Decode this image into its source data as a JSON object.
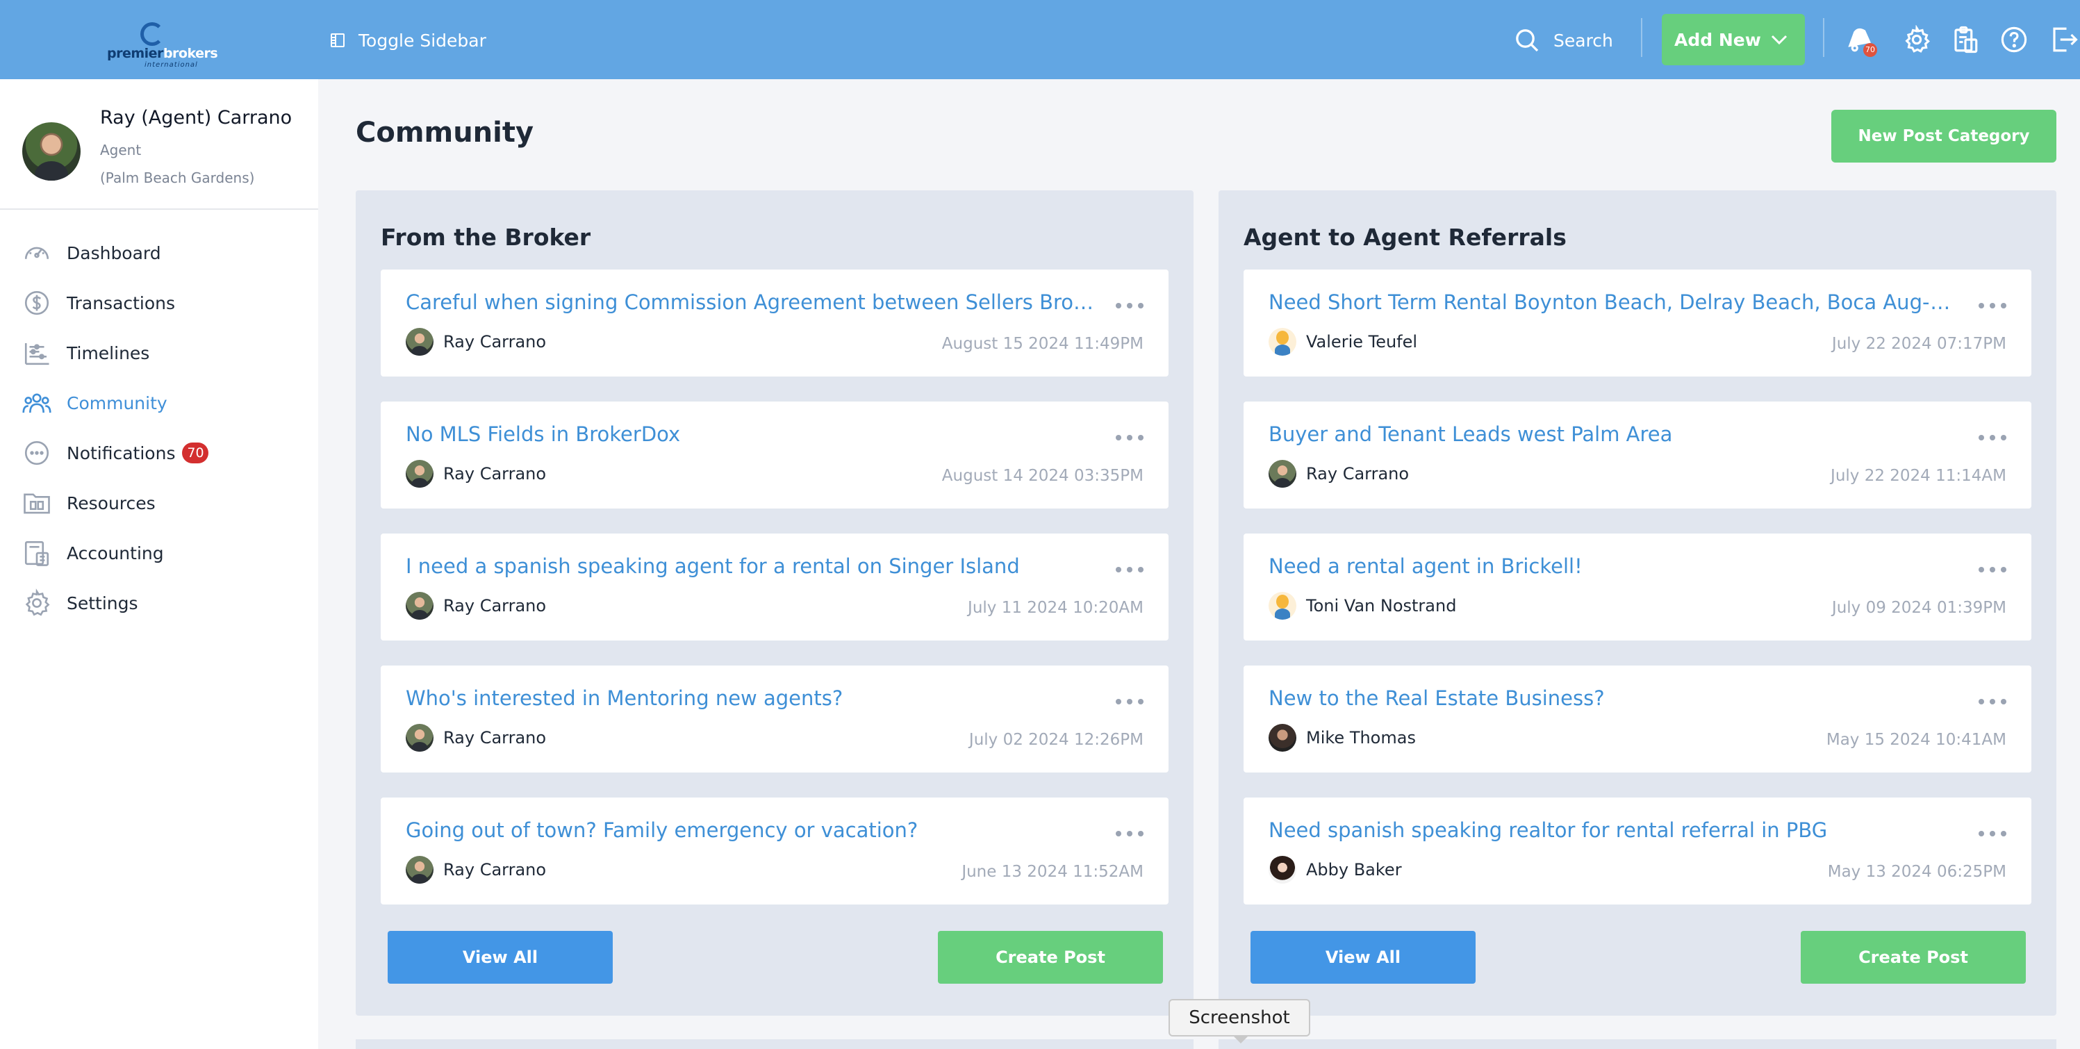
{
  "header": {
    "logo_text_left": "premier",
    "logo_text_right": "brokers",
    "logo_sub": "international",
    "toggle_label": "Toggle Sidebar",
    "search_label": "Search",
    "add_new_label": "Add New",
    "notification_count": "70",
    "accent_color": "#62a6e3"
  },
  "profile": {
    "name": "Ray (Agent) Carrano",
    "role": "Agent",
    "location": "(Palm Beach Gardens)"
  },
  "nav": [
    {
      "label": "Dashboard",
      "icon": "speedometer-icon"
    },
    {
      "label": "Transactions",
      "icon": "dollar-icon"
    },
    {
      "label": "Timelines",
      "icon": "timeline-icon"
    },
    {
      "label": "Community",
      "icon": "people-icon",
      "active": true
    },
    {
      "label": "Notifications",
      "icon": "chat-icon",
      "badge": "70"
    },
    {
      "label": "Resources",
      "icon": "folder-icon"
    },
    {
      "label": "Accounting",
      "icon": "calculator-icon"
    },
    {
      "label": "Settings",
      "icon": "gear-icon"
    }
  ],
  "main": {
    "title": "Community",
    "new_category_label": "New Post Category",
    "panels": [
      {
        "title": "From the Broker",
        "view_all_label": "View All",
        "create_label": "Create Post",
        "posts": [
          {
            "title": "Careful when signing Commission Agreement between Sellers Brokers",
            "author": "Ray Carrano",
            "date": "August 15 2024 11:49PM"
          },
          {
            "title": "No MLS Fields in BrokerDox",
            "author": "Ray Carrano",
            "date": "August 14 2024 03:35PM"
          },
          {
            "title": "I need a spanish speaking agent for a rental on Singer Island",
            "author": "Ray Carrano",
            "date": "July 11 2024 10:20AM"
          },
          {
            "title": "Who's interested in Mentoring new agents?",
            "author": "Ray Carrano",
            "date": "July 02 2024 12:26PM"
          },
          {
            "title": "Going out of town? Family emergency or vacation?",
            "author": "Ray Carrano",
            "date": "June 13 2024 11:52AM"
          }
        ]
      },
      {
        "title": "Agent to Agent Referrals",
        "view_all_label": "View All",
        "create_label": "Create Post",
        "posts": [
          {
            "title": "Need Short Term Rental Boynton Beach, Delray Beach, Boca Aug-Oct",
            "author": "Valerie Teufel",
            "date": "July 22 2024 07:17PM"
          },
          {
            "title": "Buyer and Tenant Leads west Palm Area",
            "author": "Ray Carrano",
            "date": "July 22 2024 11:14AM"
          },
          {
            "title": "Need a rental agent in Brickell!",
            "author": "Toni Van Nostrand",
            "date": "July 09 2024 01:39PM"
          },
          {
            "title": "New to the Real Estate Business?",
            "author": "Mike Thomas",
            "date": "May 15 2024 10:41AM"
          },
          {
            "title": "Need spanish speaking realtor for rental referral in PBG",
            "author": "Abby Baker",
            "date": "May 13 2024 06:25PM"
          }
        ]
      }
    ]
  },
  "tooltip": "Screenshot"
}
